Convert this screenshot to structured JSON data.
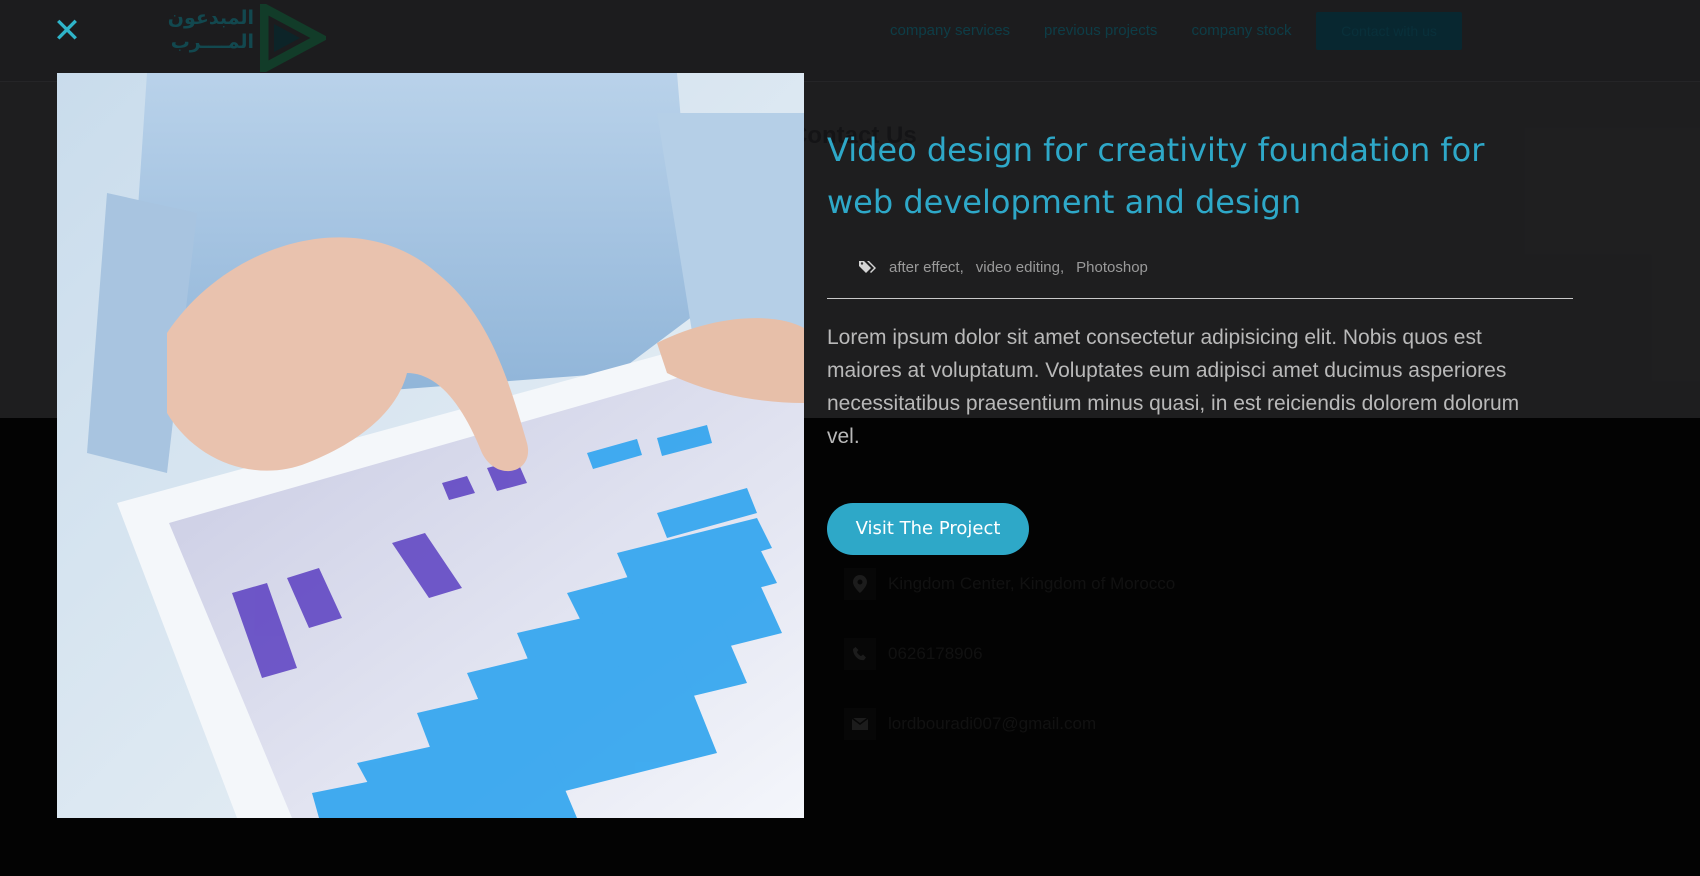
{
  "background_page": {
    "logo": {
      "text_line1": "المبدعون",
      "text_line2": "المــــرب"
    },
    "nav": {
      "links": [
        "company services",
        "previous projects",
        "company stock"
      ],
      "cta": "Contact with us"
    },
    "contact": {
      "heading": "Contact Us",
      "address": "Kingdom Center, Kingdom of Morocco",
      "phone": "0626178906",
      "email": "lordbouradi007@gmail.com"
    }
  },
  "lightbox": {
    "close_label": "✕",
    "image_icon": "tablet-chart-photo",
    "title": "Video design for creativity foundation for web development and design",
    "tags": [
      "after effect,",
      "video editing,",
      "Photoshop"
    ],
    "tag_icon": "tags-icon",
    "description": "Lorem ipsum dolor sit amet consectetur adipisicing elit. Nobis quos est maiores at voluptatum. Voluptates eum adipisci amet ducimus asperiores necessitatibus praesentium minus quasi, in est reiciendis dolorem dolorum vel.",
    "visit_button": "Visit The Project"
  },
  "colors": {
    "accent": "#2ea8c8",
    "overlay_bg": "#000000",
    "text_muted": "#b9b9b9"
  }
}
